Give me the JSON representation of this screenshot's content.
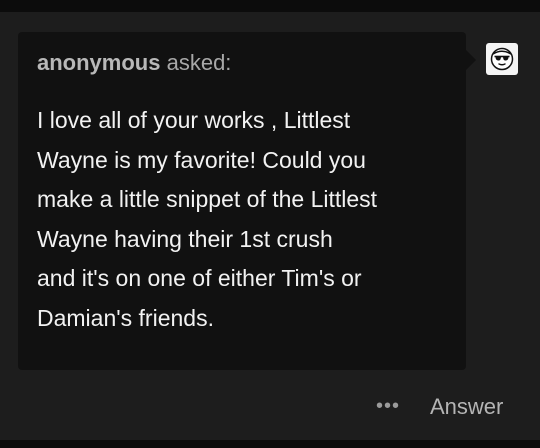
{
  "ask": {
    "asker_name": "anonymous",
    "asker_verb": "asked:",
    "question_lines": [
      "I love all of your works , Littlest",
      "Wayne is my favorite! Could you",
      "make a little snippet of the Littlest",
      "Wayne having their 1st crush",
      "and it's on one of either Tim's or",
      "Damian's friends."
    ]
  },
  "avatar": {
    "icon": "sunglasses-face-icon"
  },
  "footer": {
    "more_label": "•••",
    "answer_label": "Answer"
  },
  "colors": {
    "background": "#1d1d1d",
    "bubble": "#111111",
    "question_text": "#f2f2f2",
    "asker_text": "#b8b8b8"
  }
}
